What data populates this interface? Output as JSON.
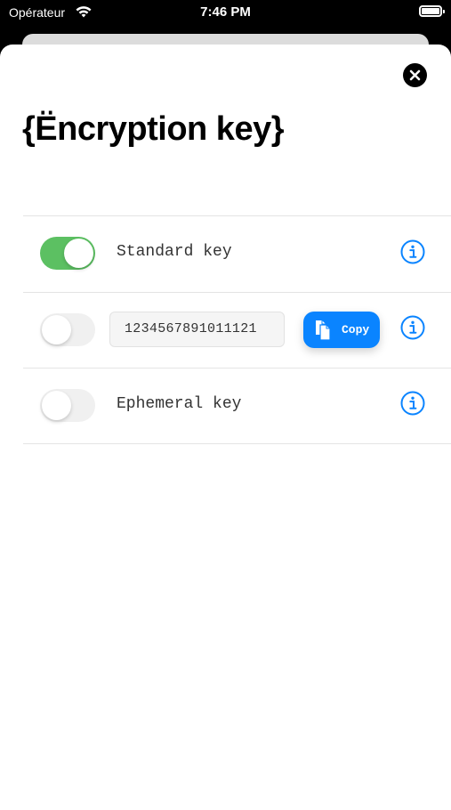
{
  "status_bar": {
    "carrier": "Opérateur",
    "time": "7:46 PM",
    "wifi_icon": "wifi-icon",
    "battery_icon": "battery-icon"
  },
  "sheet": {
    "title": "{Ëncryption key}",
    "close_icon": "close-icon"
  },
  "options": [
    {
      "label": "Standard key",
      "enabled": true,
      "info_icon": "info-icon"
    },
    {
      "key_value": "1234567891011121",
      "enabled": false,
      "copy_label": "Copy",
      "copy_icon": "document-icon",
      "info_icon": "info-icon"
    },
    {
      "label": "Ephemeral key",
      "enabled": false,
      "info_icon": "info-icon"
    }
  ],
  "colors": {
    "accent": "#0a84ff",
    "toggle_on": "#5cc062",
    "toggle_off": "#f0f0f0"
  }
}
